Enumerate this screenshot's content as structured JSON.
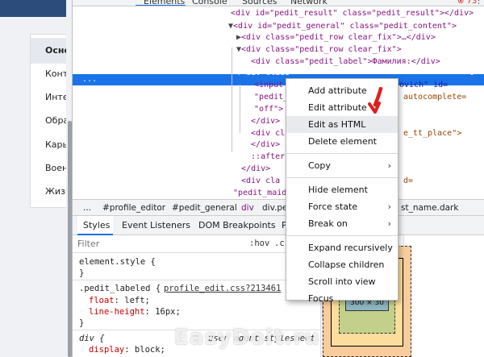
{
  "page_menu": {
    "items": [
      "Осно",
      "Конт",
      "Инте",
      "Обра",
      "Карь",
      "Воен",
      "Жизн"
    ]
  },
  "devtools": {
    "tabs": [
      "Elements",
      "Console",
      "Sources",
      "Network"
    ],
    "error_count": "73",
    "more_label": "⋮"
  },
  "dom_tree": {
    "lines": [
      {
        "indent": 0,
        "arrow": "",
        "text": "<div id=\"pedit_result\" class=\"pedit_result\"></div>"
      },
      {
        "indent": 1,
        "arrow": "▼",
        "text": "<div id=\"pedit_general\" class=\"pedit_content\">"
      },
      {
        "indent": 2,
        "arrow": "▶",
        "text": "<div class=\"pedit_row clear_fix\">…</div>"
      },
      {
        "indent": 2,
        "arrow": "▼",
        "text": "<div class=\"pedit_row clear_fix\">"
      },
      {
        "indent": 3,
        "arrow": "",
        "text": "<div class=\"pedit_label\">Фамилия:</div>"
      },
      {
        "indent": 3,
        "arrow": "▼",
        "text": "<div class",
        "selected": true,
        "suffix": "0"
      },
      {
        "indent": 4,
        "arrow": "",
        "text": "<input",
        "right": "ovich\" id="
      },
      {
        "indent": 4,
        "arrow": "",
        "text": "\"pedit_",
        "right": "autocomplete="
      },
      {
        "indent": 4,
        "arrow": "",
        "text": "\"off\">"
      },
      {
        "indent": 3,
        "arrow": "",
        "text": "</div>"
      },
      {
        "indent": 3,
        "arrow": "",
        "text": "<div clas",
        "right": "e_tt_place\">"
      },
      {
        "indent": 3,
        "arrow": "",
        "text": "</div>"
      },
      {
        "indent": 3,
        "arrow": "",
        "text": "::after"
      },
      {
        "indent": 2,
        "arrow": "",
        "text": "</div>"
      },
      {
        "indent": 2,
        "arrow": "",
        "text": "<div cla",
        "right": "d="
      },
      {
        "indent": 1,
        "arrow": "",
        "text": "\"pedit_maide"
      }
    ],
    "selected_ellipsis": "..."
  },
  "breadcrumb": {
    "items": [
      "...",
      "#profile_editor",
      "#pedit_general",
      "div",
      "div.pe",
      "st_name.dark"
    ]
  },
  "styles_tabs": {
    "items": [
      "Styles",
      "Event Listeners",
      "DOM Breakpoints",
      "P"
    ]
  },
  "filter": {
    "placeholder": "Filter",
    "hov": ":hov",
    "cls": ".c"
  },
  "styles": {
    "element_style_selector": "element.style {",
    "element_style_close": "}",
    "rule1_selector": ".pedit_labeled {",
    "rule1_source": "profile_edit.css?213461",
    "rule1_prop1": "float",
    "rule1_val1": "left;",
    "rule1_prop2": "line-height",
    "rule1_val2": "16px;",
    "rule1_close": "}",
    "rule2_selector": "div {",
    "rule2_source": "user agent stylesheet",
    "rule2_prop1": "display",
    "rule2_val1": "block;"
  },
  "box_model": {
    "content_size": "300 × 30"
  },
  "context_menu": {
    "items": [
      {
        "label": "Add attribute",
        "has_submenu": false
      },
      {
        "label": "Edit attribute",
        "has_submenu": false
      },
      {
        "label": "Edit as HTML",
        "has_submenu": false,
        "hover": true
      },
      {
        "label": "Delete element",
        "has_submenu": false
      },
      {
        "label": "Copy",
        "has_submenu": true,
        "separator_before": true
      },
      {
        "label": "Hide element",
        "has_submenu": false,
        "separator_before": true
      },
      {
        "label": "Force state",
        "has_submenu": true
      },
      {
        "label": "Break on",
        "has_submenu": true
      },
      {
        "label": "Expand recursively",
        "has_submenu": false,
        "separator_before": true
      },
      {
        "label": "Collapse children",
        "has_submenu": false
      },
      {
        "label": "Scroll into view",
        "has_submenu": false
      },
      {
        "label": "Focus",
        "has_submenu": false
      }
    ]
  },
  "watermark": "EasyDoit.ru",
  "colors": {
    "selection": "#1a73e8",
    "annotation_red": "#e11d1d",
    "page_header": "#2c4c7c"
  }
}
